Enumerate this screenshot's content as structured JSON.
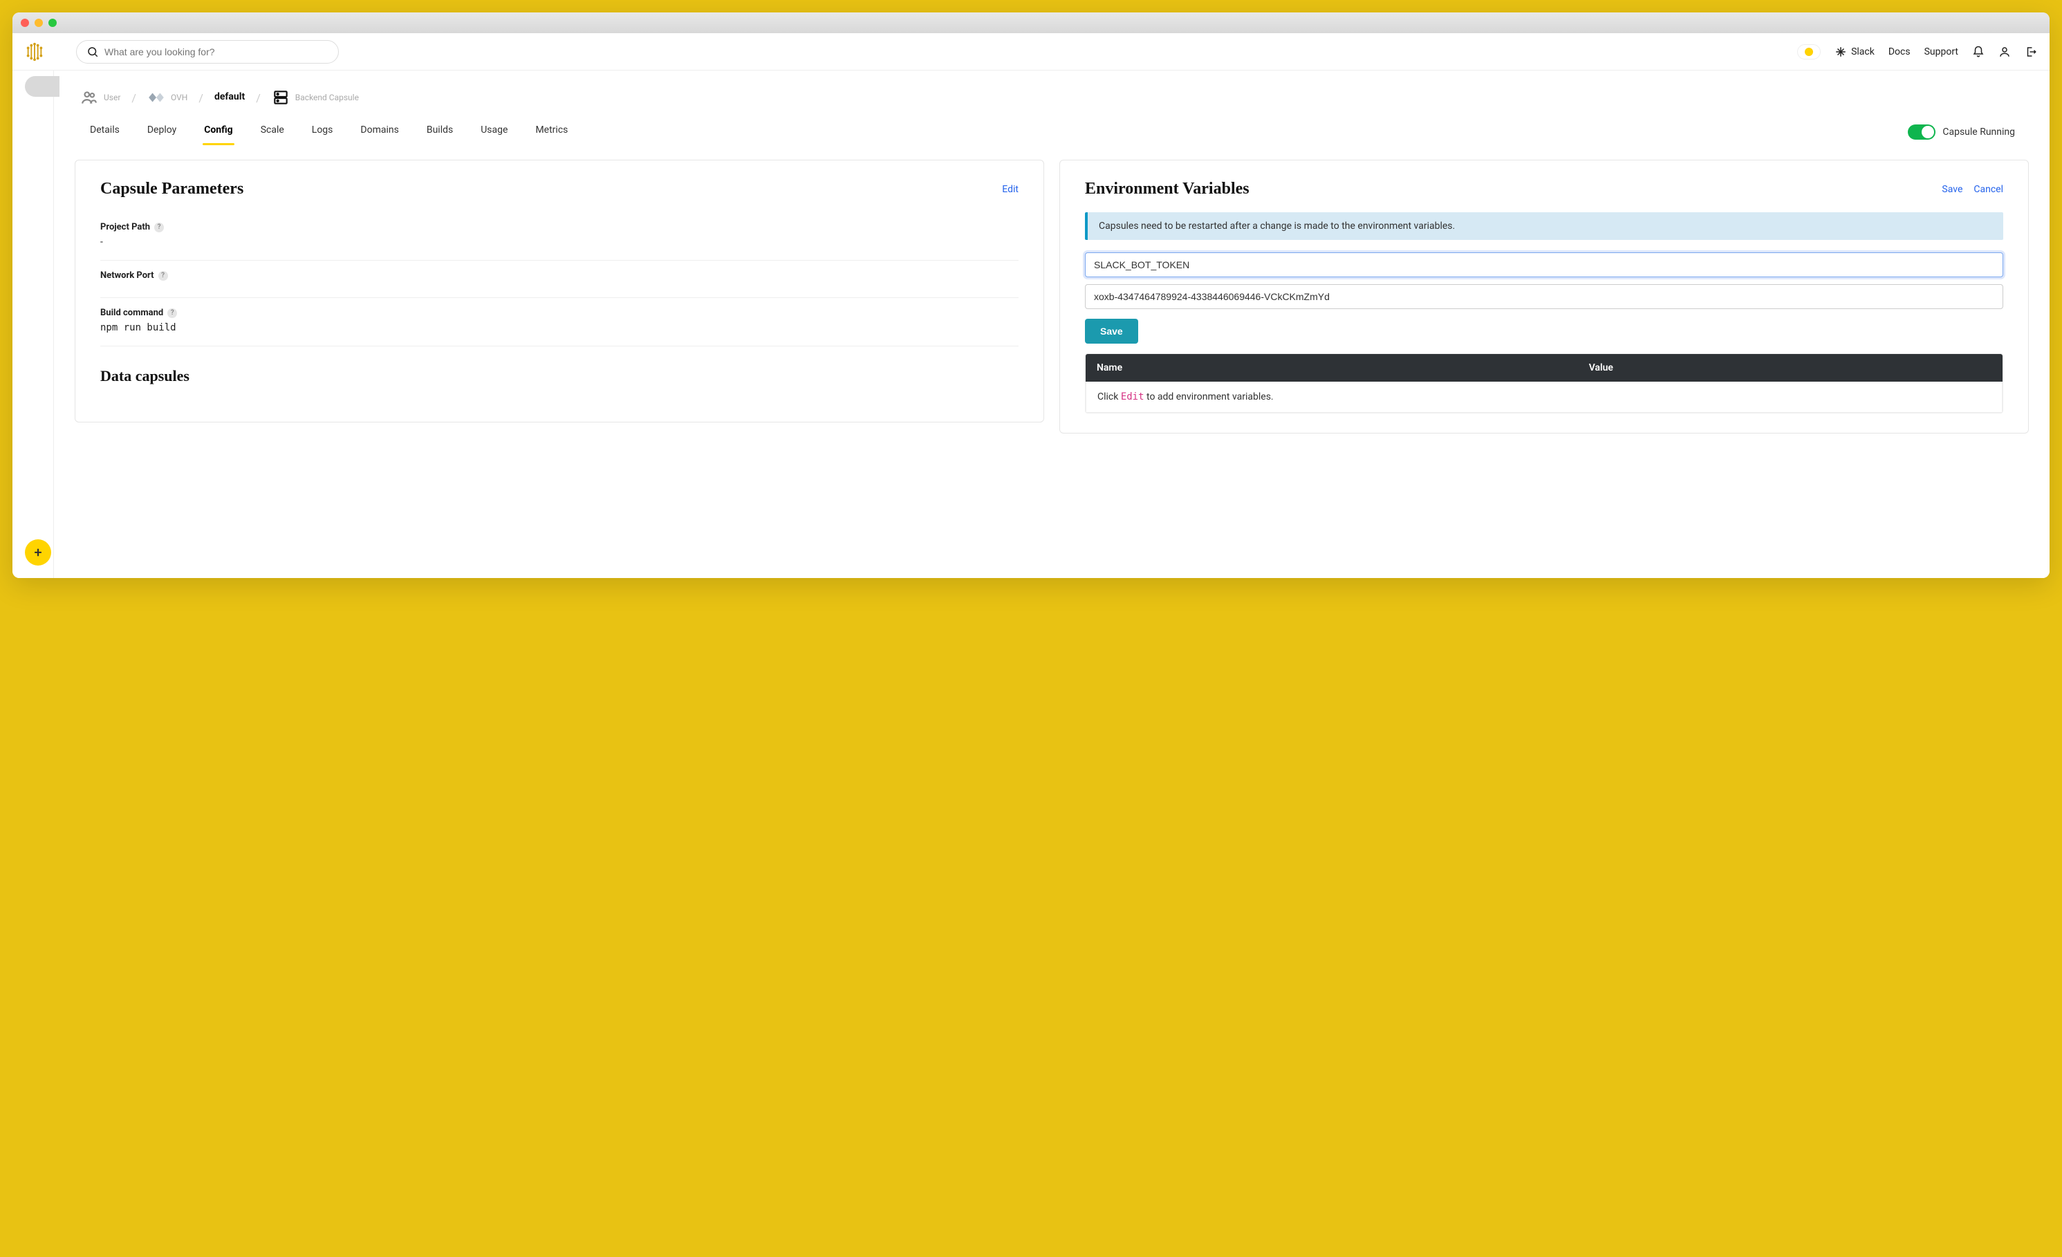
{
  "search": {
    "placeholder": "What are you looking for?"
  },
  "topbar": {
    "slack": "Slack",
    "docs": "Docs",
    "support": "Support"
  },
  "breadcrumb": {
    "user": "User",
    "provider": "OVH",
    "project": "default",
    "capsule": "Backend Capsule"
  },
  "tabs": {
    "items": [
      "Details",
      "Deploy",
      "Config",
      "Scale",
      "Logs",
      "Domains",
      "Builds",
      "Usage",
      "Metrics"
    ],
    "activeIndex": 2,
    "status_label": "Capsule Running"
  },
  "left": {
    "title": "Capsule Parameters",
    "edit": "Edit",
    "params": {
      "project_path": {
        "label": "Project Path",
        "value": "-"
      },
      "network_port": {
        "label": "Network Port",
        "value": ""
      },
      "build_cmd": {
        "label": "Build command",
        "value": "npm run build"
      }
    },
    "data_capsules": "Data capsules"
  },
  "right": {
    "title": "Environment Variables",
    "save": "Save",
    "cancel": "Cancel",
    "notice": "Capsules need to be restarted after a change is made to the environment variables.",
    "key_input": "SLACK_BOT_TOKEN",
    "val_input": "xoxb-4347464789924-4338446069446-VCkCKmZmYd",
    "save_btn": "Save",
    "table": {
      "col_name": "Name",
      "col_value": "Value"
    },
    "empty_pre": "Click ",
    "empty_edit": "Edit",
    "empty_post": " to add environment variables."
  },
  "fab": "+"
}
